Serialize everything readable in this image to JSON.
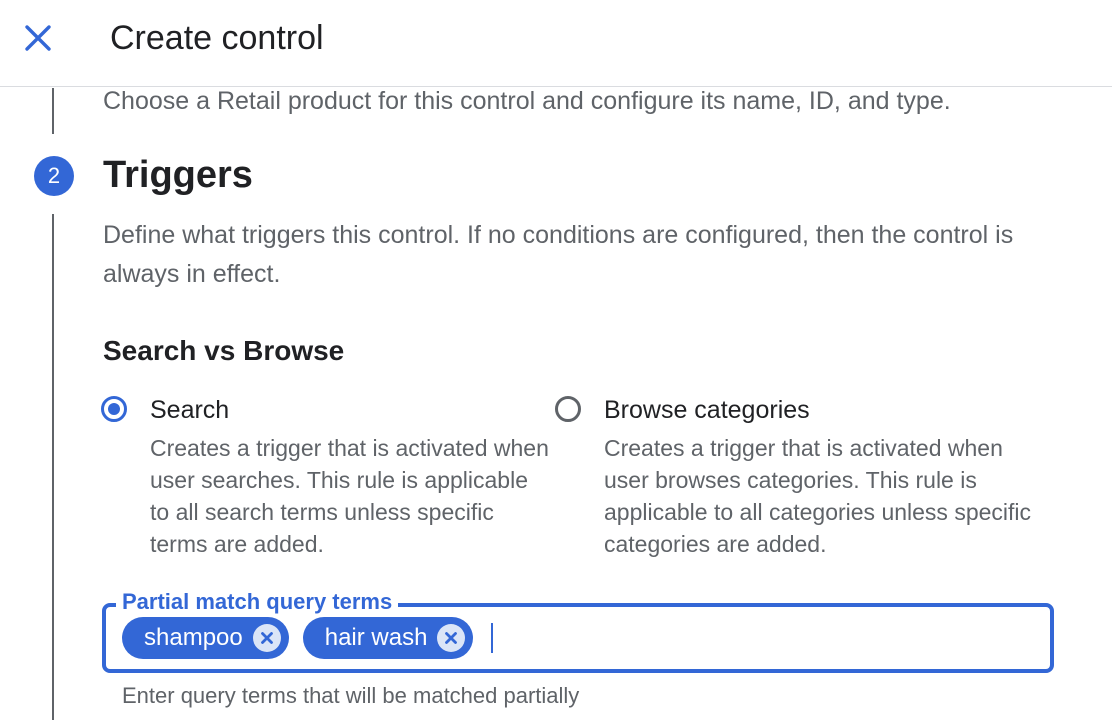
{
  "header": {
    "title": "Create control",
    "close_icon": "close-icon"
  },
  "previous_step": {
    "description": "Choose a Retail product for this control and configure its name, ID, and type."
  },
  "step": {
    "number": "2",
    "title": "Triggers",
    "description": "Define what triggers this control. If no conditions are configured, then the control is always in effect."
  },
  "search_vs_browse": {
    "heading": "Search vs Browse",
    "selected": "search",
    "options": [
      {
        "id": "search",
        "label": "Search",
        "description": "Creates a trigger that is activated when user searches. This rule is applicable to all search terms unless specific terms are added."
      },
      {
        "id": "browse",
        "label": "Browse categories",
        "description": "Creates a trigger that is activated when user browses categories. This rule is applicable to all categories unless specific categories are added."
      }
    ]
  },
  "query_terms_field": {
    "label": "Partial match query terms",
    "chips": [
      "shampoo",
      "hair wash"
    ],
    "input_value": "",
    "helper_text": "Enter query terms that will be matched partially"
  },
  "colors": {
    "accent": "#3367d6",
    "text_primary": "#202124",
    "text_secondary": "#5f6368",
    "divider": "#dadce0"
  }
}
